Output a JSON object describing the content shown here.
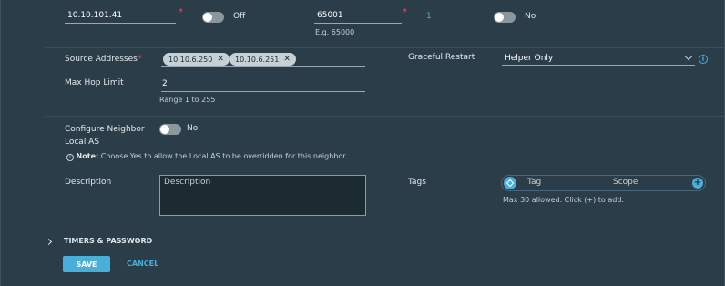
{
  "row1": {
    "neighbor_ip_value": "10.10.101.41",
    "bfd_toggle_label": "Off",
    "remote_as_value": "65001",
    "remote_as_hint": "E.g. 65000",
    "count_value": "1",
    "allowas_toggle_label": "No"
  },
  "source_addresses": {
    "label": "Source Addresses",
    "chips": [
      "10.10.6.250",
      "10.10.6.251"
    ]
  },
  "graceful_restart": {
    "label": "Graceful Restart",
    "value": "Helper Only"
  },
  "max_hop": {
    "label": "Max Hop Limit",
    "value": "2",
    "hint": "Range 1 to 255"
  },
  "local_as": {
    "label_line1": "Configure Neighbor",
    "label_line2": "Local AS",
    "toggle_label": "No",
    "note_prefix": "Note:",
    "note_text": " Choose Yes to allow the Local AS to be overridden for this neighbor"
  },
  "description": {
    "label": "Description",
    "placeholder": "Description"
  },
  "tags": {
    "label": "Tags",
    "tag_placeholder": "Tag",
    "scope_placeholder": "Scope",
    "hint": "Max 30 allowed. Click (+) to add."
  },
  "timers": {
    "label": "TIMERS & PASSWORD"
  },
  "actions": {
    "save_label": "SAVE",
    "cancel_label": "CANCEL"
  }
}
